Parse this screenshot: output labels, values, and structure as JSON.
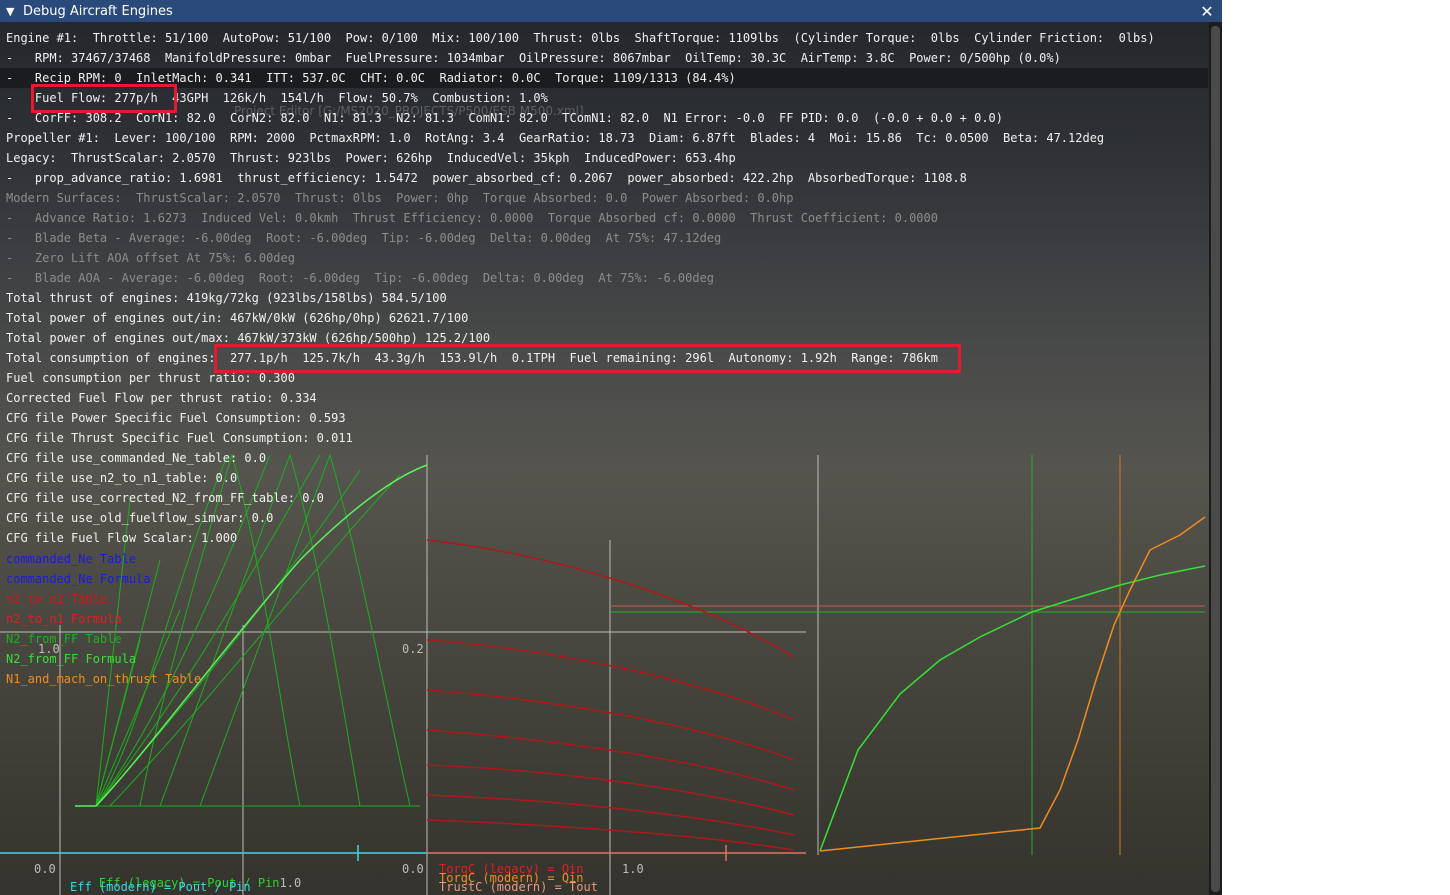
{
  "window": {
    "title": "Debug Aircraft Engines",
    "collapse_icon": "triangle-down-icon",
    "close_icon": "close-icon"
  },
  "ghost_text": "Project Editor [G:/MS2020_PROJECTS/P500/ESB M500.xml]",
  "lines": [
    {
      "text": "Engine #1:  Throttle: 51/100  AutoPow: 51/100  Pow: 0/100  Mix: 100/100  Thrust: 0lbs  ShaftTorque: 1109lbs  (Cylinder Torque:  0lbs  Cylinder Friction:  0lbs)",
      "dim": false
    },
    {
      "text": "-   RPM: 37467/37468  ManifoldPressure: 0mbar  FuelPressure: 1034mbar  OilPressure: 8067mbar  OilTemp: 30.3C  AirTemp: 3.8C  Power: 0/500hp (0.0%)",
      "dim": false
    },
    {
      "text": "-   Recip RPM: 0  InletMach: 0.341  ITT: 537.0C  CHT: 0.0C  Radiator: 0.0C  Torque: 1109/1313 (84.4%)",
      "dim": false
    },
    {
      "text": "-   Fuel Flow: 277p/h  43GPH  126k/h  154l/h  Flow: 50.7%  Combustion: 1.0%",
      "dim": false
    },
    {
      "text": "-   CorFF: 308.2  CorN1: 82.0  CorN2: 82.0  N1: 81.3  N2: 81.3  ComN1: 82.0  TComN1: 82.0  N1 Error: -0.0  FF PID: 0.0  (-0.0 + 0.0 + 0.0)",
      "dim": false
    },
    {
      "text": "Propeller #1:  Lever: 100/100  RPM: 2000  PctmaxRPM: 1.0  RotAng: 3.4  GearRatio: 18.73  Diam: 6.87ft  Blades: 4  Moi: 15.86  Tc: 0.0500  Beta: 47.12deg",
      "dim": false
    },
    {
      "text": "Legacy:  ThrustScalar: 2.0570  Thrust: 923lbs  Power: 626hp  InducedVel: 35kph  InducedPower: 653.4hp",
      "dim": false
    },
    {
      "text": "-   prop_advance_ratio: 1.6981  thrust_efficiency: 1.5472  power_absorbed_cf: 0.2067  power_absorbed: 422.2hp  AbsorbedTorque: 1108.8",
      "dim": false
    },
    {
      "text": "Modern Surfaces:  ThrustScalar: 2.0570  Thrust: 0lbs  Power: 0hp  Torque Absorbed: 0.0  Power Absorbed: 0.0hp",
      "dim": true
    },
    {
      "text": "-   Advance Ratio: 1.6273  Induced Vel: 0.0kmh  Thrust Efficiency: 0.0000  Torque Absorbed cf: 0.0000  Thrust Coefficient: 0.0000",
      "dim": true
    },
    {
      "text": "-   Blade Beta - Average: -6.00deg  Root: -6.00deg  Tip: -6.00deg  Delta: 0.00deg  At 75%: 47.12deg",
      "dim": true
    },
    {
      "text": "-   Zero Lift AOA offset At 75%: 6.00deg",
      "dim": true
    },
    {
      "text": "-   Blade AOA - Average: -6.00deg  Root: -6.00deg  Tip: -6.00deg  Delta: 0.00deg  At 75%: -6.00deg",
      "dim": true
    },
    {
      "text": "Total thrust of engines: 419kg/72kg (923lbs/158lbs) 584.5/100",
      "dim": false
    },
    {
      "text": "Total power of engines out/in: 467kW/0kW (626hp/0hp) 62621.7/100",
      "dim": false
    },
    {
      "text": "Total power of engines out/max: 467kW/373kW (626hp/500hp) 125.2/100",
      "dim": false
    },
    {
      "text": "Total consumption of engines:  277.1p/h  125.7k/h  43.3g/h  153.9l/h  0.1TPH  Fuel remaining: 296l  Autonomy: 1.92h  Range: 786km",
      "dim": false
    },
    {
      "text": "Fuel consumption per thrust ratio: 0.300",
      "dim": false
    },
    {
      "text": "Corrected Fuel Flow per thrust ratio: 0.334",
      "dim": false
    },
    {
      "text": "CFG file Power Specific Fuel Consumption: 0.593",
      "dim": false
    },
    {
      "text": "CFG file Thrust Specific Fuel Consumption: 0.011",
      "dim": false
    },
    {
      "text": "CFG file use_commanded_Ne_table: 0.0",
      "dim": false
    },
    {
      "text": "CFG file use_n2_to_n1_table: 0.0",
      "dim": false
    },
    {
      "text": "CFG file use_corrected_N2_from_FF_table: 0.0",
      "dim": false
    },
    {
      "text": "CFG file use_old_fuelflow_simvar: 0.0",
      "dim": false
    },
    {
      "text": "CFG file Fuel Flow Scalar: 1.000",
      "dim": false
    }
  ],
  "legend": [
    {
      "text": "commanded_Ne Table",
      "color": "#1a1ae0"
    },
    {
      "text": "commanded_Ne Formula",
      "color": "#1a1ae0"
    },
    {
      "text": "n2_to_n1 Table",
      "color": "#d01818"
    },
    {
      "text": "n2_to_n1 Formula",
      "color": "#e02020"
    },
    {
      "text": "N2_from_FF Table",
      "color": "#1cb01c"
    },
    {
      "text": "N2_from_FF Formula",
      "color": "#36e036"
    },
    {
      "text": "N1_and_mach_on_thrust Table",
      "color": "#f08c20"
    }
  ],
  "graph_labels": {
    "g1_top": "1.0",
    "g1_mid": "0.2",
    "g1_zero_a": "0.0",
    "g1_zero_b": "0.0",
    "eff_legacy": "Eff (legacy) = Pout / Pin",
    "eff_legacy_suffix": "1.0",
    "eff_modern": "Eff (modern) = Pout / Pin",
    "torq_legacy": "TorqC (legacy) = Qin",
    "torq_modern": "TorqC (modern) = Qin",
    "trust_modern": "TrustC (modern) = Tout",
    "g3_one": "1.0"
  },
  "colors": {
    "titlebar": "#294a7a",
    "highlight_box": "#e8192e",
    "green": "#2ed02e",
    "red": "#c01818",
    "orange": "#f08c20",
    "cyan": "#3ad8e8"
  }
}
